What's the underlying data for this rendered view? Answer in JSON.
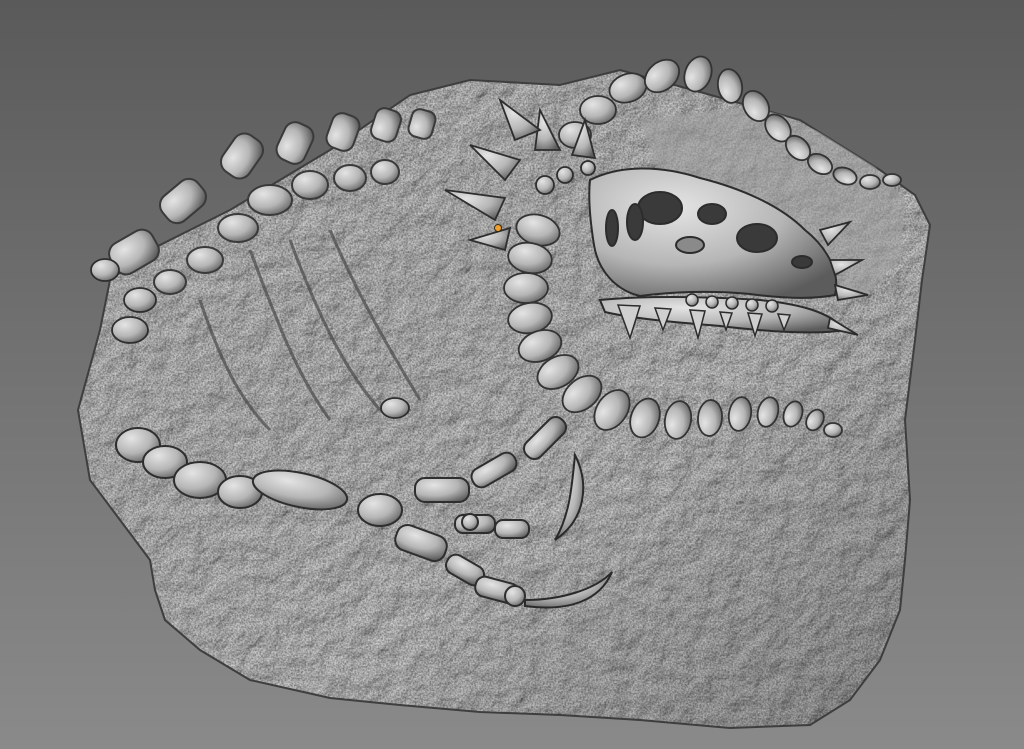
{
  "viewport": {
    "background_top": "#5a5a5a",
    "background_bottom": "#8a8a8a"
  },
  "model": {
    "subject": "dragon-fossil-relief-sculpt",
    "material_color": "#b8b8b8",
    "shadow_color": "#3c3c3c",
    "highlight_color": "#e6e6e6"
  },
  "origin_marker": {
    "color": "#f0a030"
  }
}
